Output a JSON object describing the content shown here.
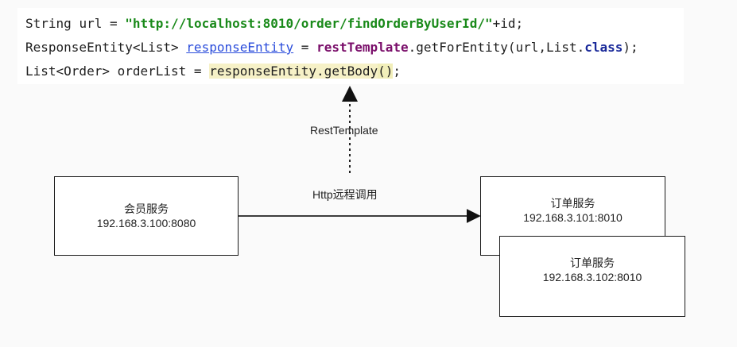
{
  "code": {
    "line1": {
      "type": "String",
      "var": "url",
      "eq": " = ",
      "string": "\"http://localhost:8010/order/findOrderByUserId/\"",
      "rest": "+id;"
    },
    "line2": {
      "type": "ResponseEntity<List> ",
      "var": "responseEntity",
      "eq": " = ",
      "obj": "restTemplate",
      "call": ".getForEntity(url,List.",
      "kw": "class",
      "end": ");"
    },
    "line3": {
      "type": "List<Order> orderList = ",
      "expr": "responseEntity.getBody",
      "paren": "()",
      "end": ";"
    }
  },
  "diagram": {
    "rest_template_label": "RestTemplate",
    "http_label": "Http远程调用",
    "member_service": {
      "name": "会员服务",
      "address": "192.168.3.100:8080"
    },
    "order_service_1": {
      "name": "订单服务",
      "address": "192.168.3.101:8010"
    },
    "order_service_2": {
      "name": "订单服务",
      "address": "192.168.3.102:8010"
    }
  }
}
